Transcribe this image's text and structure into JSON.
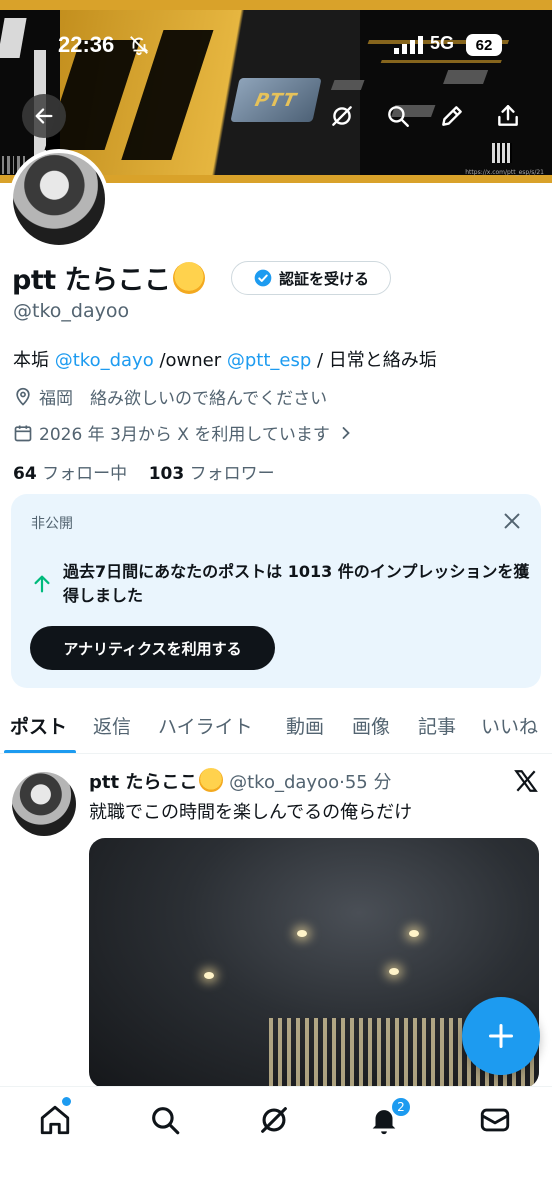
{
  "status_bar": {
    "time": "22:36",
    "network": "5G",
    "battery": "62"
  },
  "banner": {
    "logo_text": "PTT",
    "url_text": "https://x.com/ptt_esp/s/21"
  },
  "profile": {
    "name": "ptt たらここ",
    "verify_label": "認証を受ける",
    "handle": "@tko_dayoo",
    "bio_prefix": "本垢 ",
    "bio_link1": "@tko_dayo",
    "bio_mid": " /owner ",
    "bio_link2": "@ptt_esp",
    "bio_suffix": " / 日常と絡み垢",
    "location": "福岡　絡み欲しいので絡んでください",
    "joined": "2026 年 3月から X を利用しています",
    "following_count": "64",
    "following_label": "フォロー中",
    "followers_count": "103",
    "followers_label": "フォロワー"
  },
  "private_card": {
    "label": "非公開",
    "text": "過去7日間にあなたのポストは 1013 件のインプレッションを獲得しました",
    "button": "アナリティクスを利用する"
  },
  "tabs": [
    "ポスト",
    "返信",
    "ハイライト",
    "動画",
    "画像",
    "記事",
    "いいね"
  ],
  "post": {
    "name": "ptt たらここ",
    "handle": "@tko_dayoo",
    "time": "·55 分",
    "text": "就職でこの時間を楽しんでるの俺らだけ"
  },
  "bottom_nav": {
    "notification_count": "2"
  },
  "colors": {
    "accent": "#1d9bf0",
    "banner_gold": "#d9a22a",
    "text": "#0f1419",
    "muted": "#536471"
  },
  "icons": [
    "back-arrow-icon",
    "grok-icon",
    "search-icon",
    "edit-icon",
    "share-icon",
    "verified-badge-icon",
    "location-icon",
    "calendar-icon",
    "chevron-right-icon",
    "close-icon",
    "arrow-up-icon",
    "x-logo-icon",
    "plus-icon",
    "home-icon",
    "bell-icon",
    "mail-icon"
  ]
}
